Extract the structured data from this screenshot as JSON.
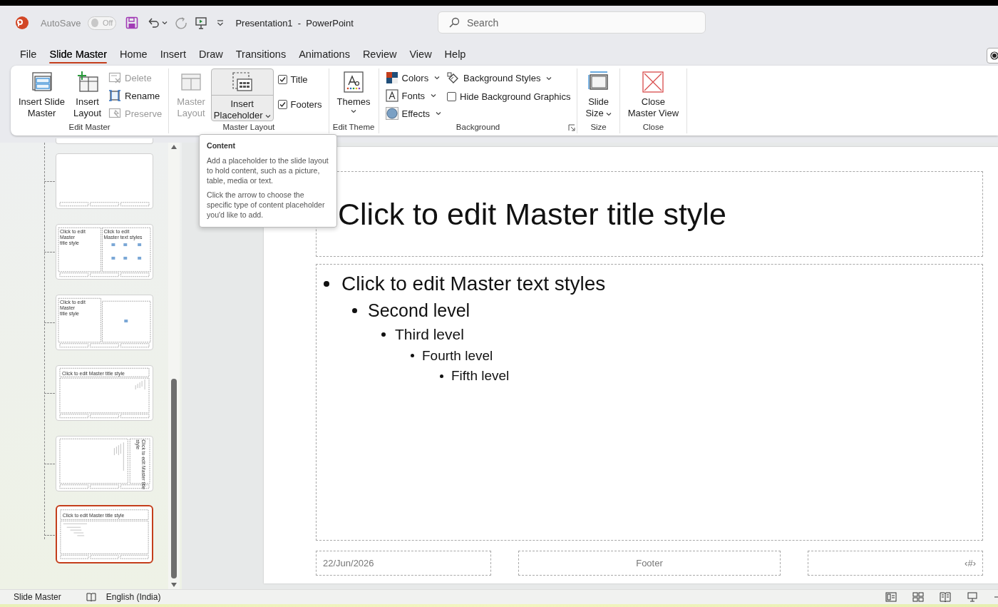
{
  "titlebar": {
    "autosave_label": "AutoSave",
    "autosave_on": false,
    "autosave_state": "Off",
    "document_title": "Presentation1  -  PowerPoint",
    "search_placeholder": "Search"
  },
  "tabs": [
    {
      "label": "File",
      "selected": false
    },
    {
      "label": "Slide Master",
      "selected": true
    },
    {
      "label": "Home",
      "selected": false
    },
    {
      "label": "Insert",
      "selected": false
    },
    {
      "label": "Draw",
      "selected": false
    },
    {
      "label": "Transitions",
      "selected": false
    },
    {
      "label": "Animations",
      "selected": false
    },
    {
      "label": "Review",
      "selected": false
    },
    {
      "label": "View",
      "selected": false
    },
    {
      "label": "Help",
      "selected": false
    }
  ],
  "ribbon": {
    "groups": [
      {
        "label": "Edit Master",
        "dialog_launcher": false,
        "items": [
          {
            "kind": "large",
            "label": "Insert Slide\nMaster",
            "disabled": false,
            "dropdown": false,
            "highlighted": false
          },
          {
            "kind": "large",
            "label": "Insert\nLayout",
            "disabled": false,
            "dropdown": false,
            "highlighted": false
          },
          {
            "kind": "small",
            "label": "Delete",
            "disabled": true,
            "dropdown": false,
            "highlighted": false
          },
          {
            "kind": "small",
            "label": "Rename",
            "disabled": false,
            "dropdown": false,
            "highlighted": false
          },
          {
            "kind": "small",
            "label": "Preserve",
            "disabled": true,
            "dropdown": false,
            "highlighted": false
          }
        ]
      },
      {
        "label": "Master Layout",
        "dialog_launcher": false,
        "items": [
          {
            "kind": "large",
            "label": "Master\nLayout",
            "disabled": true,
            "dropdown": false,
            "highlighted": false
          },
          {
            "kind": "large",
            "label": "Insert\nPlaceholder",
            "disabled": false,
            "dropdown": true,
            "highlighted": true
          },
          {
            "kind": "checkbox",
            "label": "Title",
            "checked": true
          },
          {
            "kind": "checkbox",
            "label": "Footers",
            "checked": true
          }
        ]
      },
      {
        "label": "Edit Theme",
        "dialog_launcher": false,
        "items": [
          {
            "kind": "large",
            "label": "Themes",
            "disabled": false,
            "dropdown": true,
            "highlighted": false
          }
        ]
      },
      {
        "label": "Background",
        "dialog_launcher": true,
        "items": [
          {
            "kind": "small",
            "label": "Colors",
            "disabled": false,
            "dropdown": true,
            "highlighted": false
          },
          {
            "kind": "small",
            "label": "Fonts",
            "disabled": false,
            "dropdown": true,
            "highlighted": false
          },
          {
            "kind": "small",
            "label": "Effects",
            "disabled": false,
            "dropdown": true,
            "highlighted": false
          },
          {
            "kind": "break"
          },
          {
            "kind": "small",
            "label": "Background Styles",
            "disabled": false,
            "dropdown": true,
            "highlighted": false
          },
          {
            "kind": "checkbox",
            "label": "Hide Background Graphics",
            "checked": false
          }
        ]
      },
      {
        "label": "Size",
        "dialog_launcher": false,
        "items": [
          {
            "kind": "large",
            "label": "Slide\nSize",
            "disabled": false,
            "dropdown": true,
            "highlighted": false
          }
        ]
      },
      {
        "label": "Close",
        "dialog_launcher": false,
        "items": [
          {
            "kind": "large",
            "label": "Close\nMaster View",
            "disabled": false,
            "dropdown": false,
            "highlighted": false
          }
        ]
      }
    ]
  },
  "tooltip": {
    "title": "Content",
    "paragraphs": [
      "Add a placeholder to the slide layout to hold content, such as a picture, table, media or text.",
      "Click the arrow to choose the specific type of content placeholder you'd like to add."
    ]
  },
  "thumbnails": [
    {
      "kind": "blank",
      "selected": false
    },
    {
      "kind": "two-content",
      "title": "Click to edit Master\ntitle style",
      "body": "Click to edit Master text styles",
      "selected": false
    },
    {
      "kind": "picture-caption",
      "title": "Click to edit Master\ntitle style",
      "selected": false
    },
    {
      "kind": "vertical-text",
      "title": "Click to edit Master title style",
      "selected": false
    },
    {
      "kind": "vertical-title",
      "title": "Click to edit Master title\nstyle",
      "selected": false
    },
    {
      "kind": "title-content",
      "title": "Click to edit Master title style",
      "selected": true
    }
  ],
  "slide": {
    "title": "Click to edit Master title style",
    "levels": [
      "Click to edit Master text styles",
      "Second level",
      "Third level",
      "Fourth level",
      "Fifth level"
    ],
    "date": "22/Jun/2026",
    "footer": "Footer",
    "slide_number": "‹#›"
  },
  "status_bar": {
    "view": "Slide Master",
    "language": "English (India)"
  }
}
